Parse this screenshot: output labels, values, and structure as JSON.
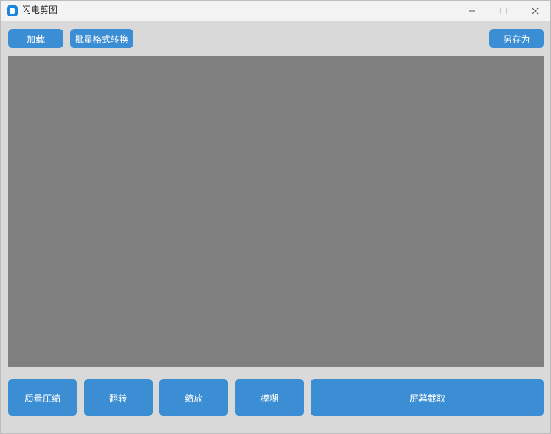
{
  "window": {
    "title": "闪电剪图"
  },
  "toolbar": {
    "load_label": "加载",
    "batch_convert_label": "批量格式转换",
    "save_as_label": "另存为"
  },
  "bottom_bar": {
    "compress_label": "质量压缩",
    "flip_label": "翻转",
    "zoom_label": "缩放",
    "blur_label": "模糊",
    "screen_capture_label": "屏幕截取"
  },
  "colors": {
    "button_bg": "#3b8ed3",
    "canvas_bg": "#808080",
    "window_bg": "#d9d9d9",
    "titlebar_bg": "#f3f3f3",
    "app_icon": "#1a86e0"
  },
  "icons": {
    "app": "app-icon",
    "minimize": "minimize-icon",
    "maximize": "maximize-icon",
    "close": "close-icon"
  }
}
